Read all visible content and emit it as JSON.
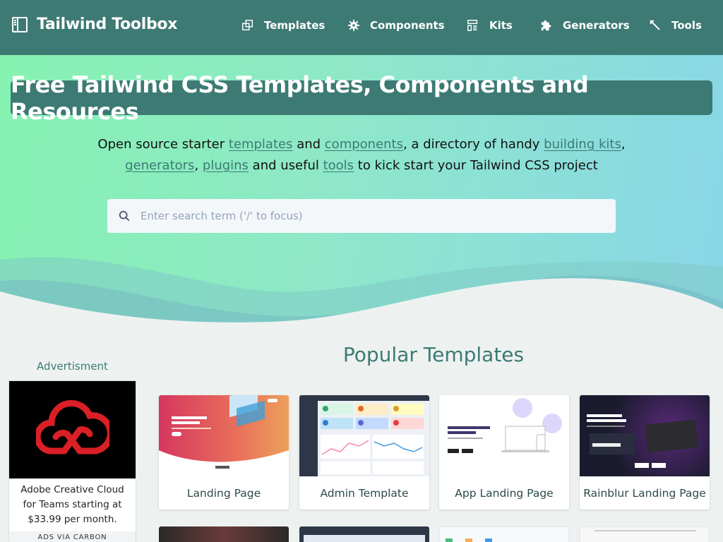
{
  "header": {
    "brand": "Tailwind Toolbox",
    "nav": [
      {
        "label": "Templates",
        "icon": "copy-icon"
      },
      {
        "label": "Components",
        "icon": "gear-icon"
      },
      {
        "label": "Kits",
        "icon": "layout-icon"
      },
      {
        "label": "Generators",
        "icon": "puzzle-icon"
      },
      {
        "label": "Tools",
        "icon": "wrench-icon"
      }
    ]
  },
  "hero": {
    "title": "Free Tailwind CSS Templates, Components and Resources",
    "sub": {
      "t1": "Open source starter ",
      "link_templates": "templates",
      "t2": " and ",
      "link_components": "components",
      "t3": ", a directory of handy ",
      "link_kits": "building kits",
      "t4": ",",
      "link_generators": "generators",
      "t5": ", ",
      "link_plugins": "plugins",
      "t6": " and useful ",
      "link_tools": "tools",
      "t7": " to kick start your Tailwind CSS project"
    },
    "search_placeholder": "Enter search term ('/' to focus)"
  },
  "sidebar": {
    "ad_label": "Advertisment",
    "ad_text": "Adobe Creative Cloud for Teams starting at $33.99 per month.",
    "ad_via": "ADS VIA CARBON"
  },
  "popular": {
    "title": "Popular Templates",
    "cards": [
      {
        "label": "Landing Page"
      },
      {
        "label": "Admin Template"
      },
      {
        "label": "App Landing Page"
      },
      {
        "label": "Rainblur Landing Page"
      }
    ]
  },
  "colors": {
    "accent": "#3d7a74",
    "hero_start": "#86f2b0",
    "hero_end": "#88d6e8"
  }
}
